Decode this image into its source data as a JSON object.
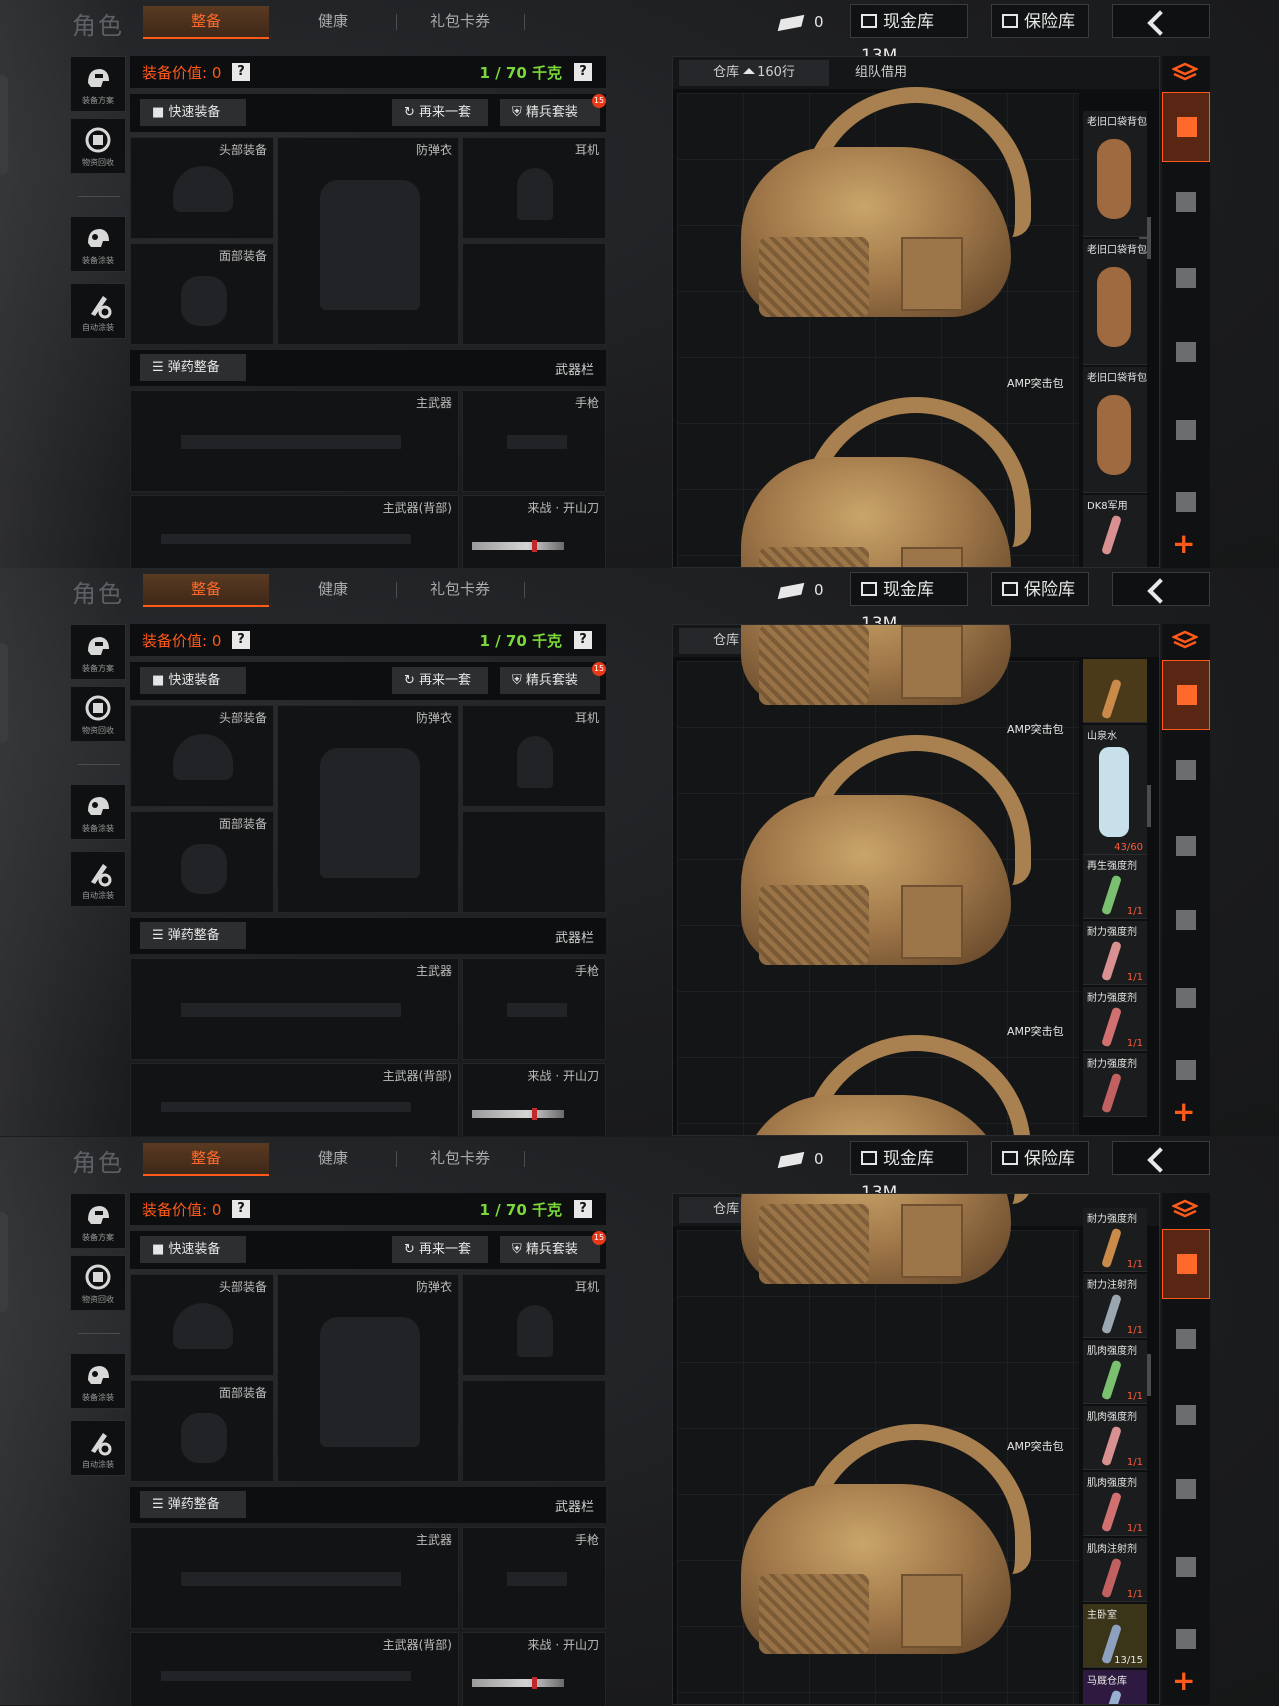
{
  "header": {
    "app_title": "角色",
    "tabs": [
      "整备",
      "健康",
      "礼包卡券"
    ],
    "currency_value": "0",
    "cash_vault": "现金库 13M",
    "safe_box": "保险库"
  },
  "sidebar": {
    "items": [
      "装备方案",
      "物资回收",
      "装备涂装",
      "自动涂装"
    ]
  },
  "loadout": {
    "value_label": "装备价值: 0",
    "weight_label": "1 / 70 千克",
    "help": "?",
    "quick_equip": "快速装备",
    "repeat_set": "再来一套",
    "elite_set": "精兵套装",
    "elite_badge": "15",
    "slots": {
      "head": "头部装备",
      "armor": "防弹衣",
      "headset": "耳机",
      "face": "面部装备",
      "primary": "主武器",
      "pistol": "手枪",
      "primary_back": "主武器(背部)",
      "melee": "来战 · 开山刀"
    },
    "ammo_btn": "弹药整备",
    "weapon_bar": "武器栏"
  },
  "warehouse": {
    "tab_storage": "仓库",
    "tab_rows": "160行",
    "tab_team": "组队借用",
    "bag_name": "AMP突击包",
    "panels": [
      {
        "items": [
          {
            "name": "老旧口袋背包",
            "count": ""
          },
          {
            "name": "老旧口袋背包",
            "count": ""
          },
          {
            "name": "老旧口袋背包",
            "count": ""
          },
          {
            "name": "DK8军用",
            "count": ""
          }
        ]
      },
      {
        "items": [
          {
            "name": "",
            "count": ""
          },
          {
            "name": "山泉水",
            "count": "43/60"
          },
          {
            "name": "再生强度剂",
            "count": "1/1"
          },
          {
            "name": "耐力强度剂",
            "count": "1/1"
          },
          {
            "name": "耐力强度剂",
            "count": "1/1"
          },
          {
            "name": "耐力强度剂",
            "count": ""
          }
        ]
      },
      {
        "items": [
          {
            "name": "耐力强度剂",
            "count": "1/1"
          },
          {
            "name": "耐力注射剂",
            "count": "1/1"
          },
          {
            "name": "肌肉强度剂",
            "count": "1/1"
          },
          {
            "name": "肌肉强度剂",
            "count": "1/1"
          },
          {
            "name": "肌肉强度剂",
            "count": "1/1"
          },
          {
            "name": "肌肉注射剂",
            "count": "1/1"
          },
          {
            "name": "主卧室",
            "count": "13/15"
          },
          {
            "name": "马厩仓库",
            "count": ""
          }
        ]
      }
    ]
  },
  "colors": {
    "accent": "#ff5a1a",
    "weight_ok": "#7bd83a",
    "bg": "#1b1c1d"
  }
}
